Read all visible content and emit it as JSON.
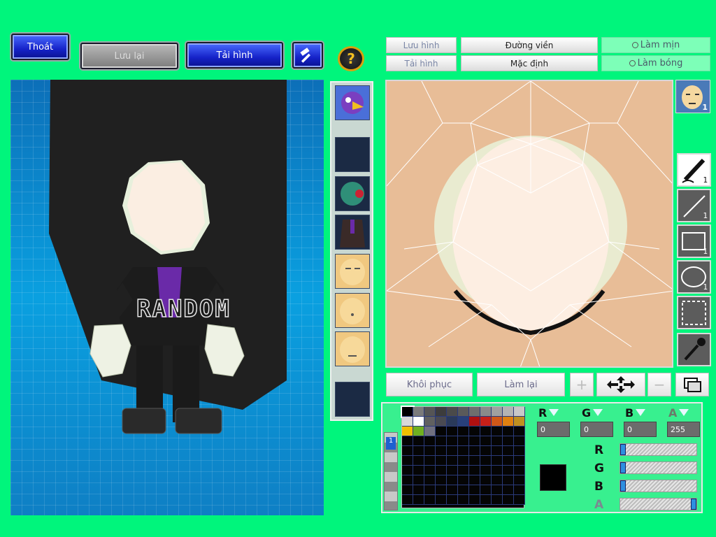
{
  "top_buttons": {
    "exit": "Thoát",
    "save": "Lưu lại",
    "reload": "Tải hình",
    "help": "?"
  },
  "editor_tabs": {
    "save_image": "Lưu hình",
    "outline": "Đường viền",
    "smooth": "Làm mịn",
    "load_image": "Tải hình",
    "default": "Mặc định",
    "shine": "Làm bóng"
  },
  "character": {
    "label": "RANDOM"
  },
  "face_thumb": {
    "count": "1"
  },
  "tools": [
    {
      "name": "pen",
      "count": "1"
    },
    {
      "name": "line",
      "count": "1"
    },
    {
      "name": "rect",
      "count": "1"
    },
    {
      "name": "ellipse",
      "count": "1"
    },
    {
      "name": "select",
      "count": ""
    },
    {
      "name": "eyedropper",
      "count": ""
    }
  ],
  "bottom_buttons": {
    "restore": "Khôi phục",
    "redo": "Làm lại",
    "plus": "+",
    "minus": "−"
  },
  "color": {
    "r_label": "R",
    "g_label": "G",
    "b_label": "B",
    "a_label": "A",
    "r": "0",
    "g": "0",
    "b": "0",
    "a": "255",
    "current": "#000000",
    "layer_index": "1"
  },
  "palette_row1": [
    "#000000",
    "#7b7b7b",
    "#555555",
    "#3c3c3c",
    "#4a4a4a",
    "#5a5a5a",
    "#6e6e6e",
    "#8a8a8a",
    "#a0a0a0",
    "#b4b4b4",
    "#c8c8c8"
  ],
  "palette_row2": [
    "#d8d8d8",
    "#ffffff",
    "#606060",
    "#4a4a52",
    "#2a3a5a",
    "#28407a",
    "#b01010",
    "#c82018",
    "#d05818",
    "#e08010",
    "#c09020"
  ],
  "palette_row3": [
    "#f0c000",
    "#70b020",
    "#707080"
  ]
}
